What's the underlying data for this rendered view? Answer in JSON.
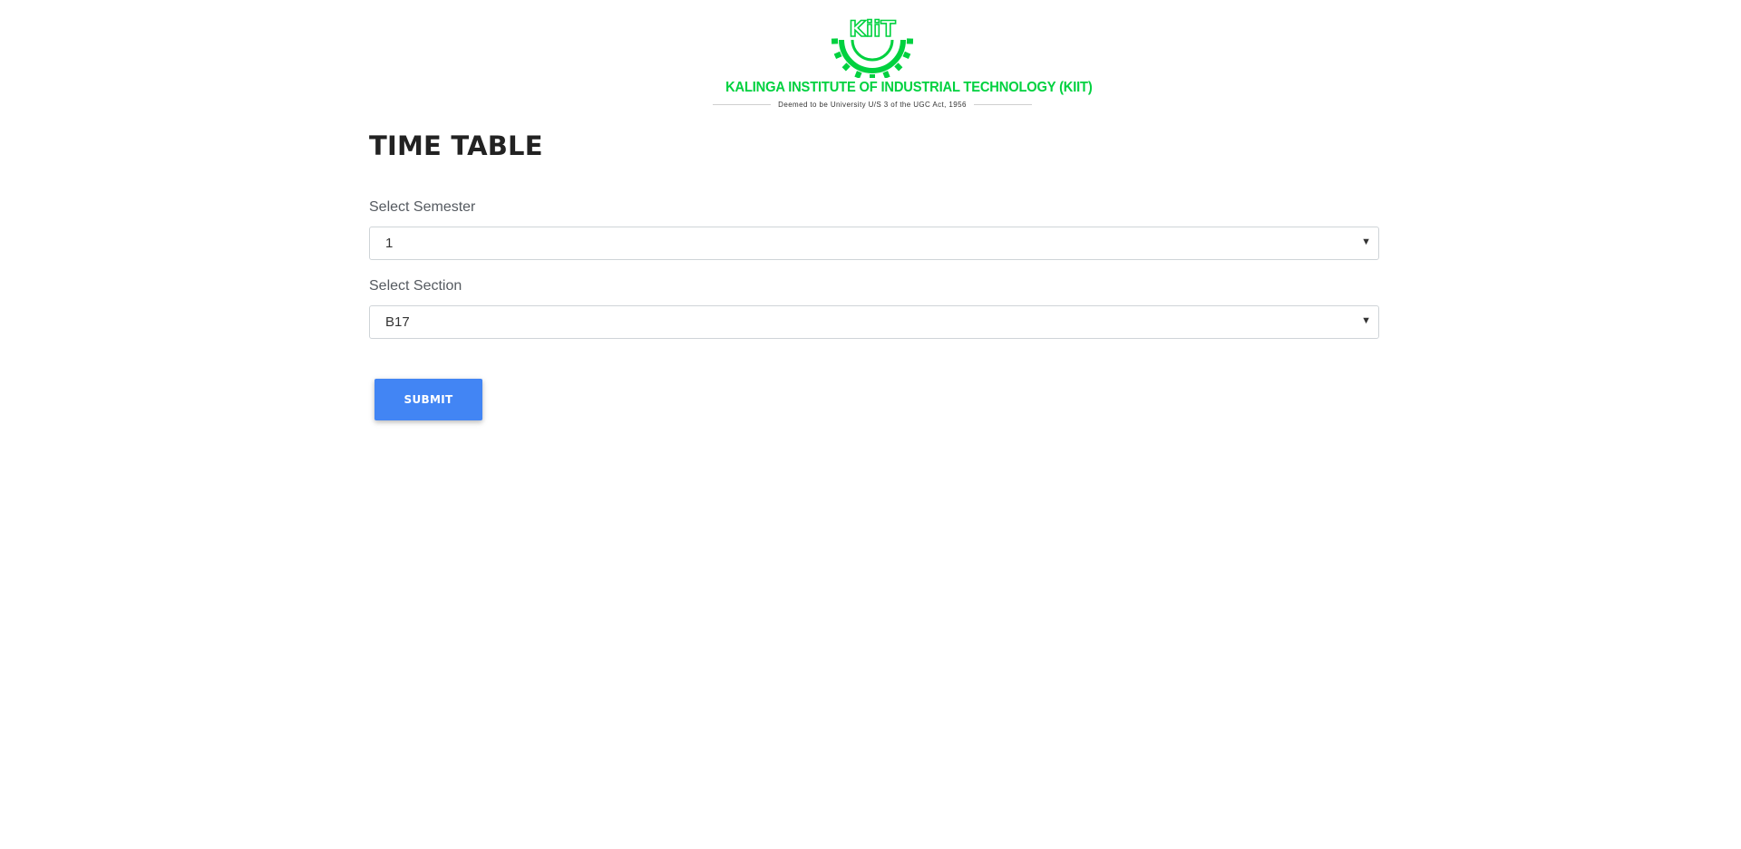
{
  "logo": {
    "mark_text": "KiiT",
    "institute_name": "KALINGA INSTITUTE OF INDUSTRIAL TECHNOLOGY (KIIT)",
    "tagline": "Deemed to be University U/S 3 of the UGC Act, 1956",
    "brand_color": "#00d13f"
  },
  "page_title": "TIME TABLE",
  "form": {
    "semester": {
      "label": "Select Semester",
      "value": "1"
    },
    "section": {
      "label": "Select Section",
      "value": "B17"
    },
    "submit_label": "SUBMIT",
    "submit_color": "#4285f4"
  }
}
